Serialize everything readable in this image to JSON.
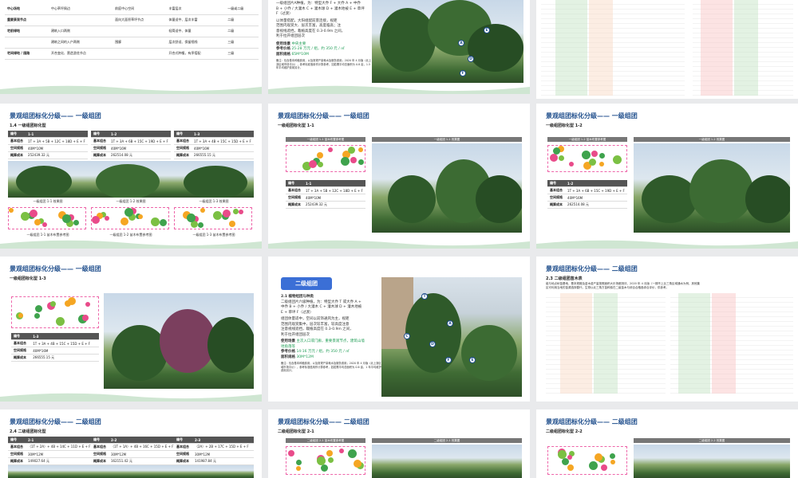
{
  "slides": {
    "s1": {
      "rows": [
        {
          "a": "中心场地",
          "b": "中心草坪周边",
          "c": "前庭中心空间",
          "d": "丰富层次",
          "e": "一级或二级"
        },
        {
          "a": "重要景观节点",
          "b": "",
          "c": "面向大面积草坪节点",
          "d": "体量适中、层次丰富",
          "e": "二级"
        },
        {
          "a": "宅前绿地",
          "b": "建筑入口两侧",
          "c": "",
          "d": "轻简适中、体量",
          "e": "二级"
        },
        {
          "a": "",
          "b": "建筑之间的入户两侧",
          "c": "围廊",
          "d": "层次舒适、保留视线",
          "e": "三级"
        },
        {
          "a": "宅间绿地 / 园路",
          "b": "开合变化、营造游览节点",
          "c": "",
          "d": "开合式种植，有序搭配",
          "e": "三级"
        }
      ]
    },
    "s2": {
      "lines": [
        "一级组团片A种植，为：特型大乔 F + 大乔 A + 中乔",
        "B + 小乔 / 大灌木 C + 灌木球 D + 灌木地被 E + 草坪",
        "F（过渡）",
        "以体量搭配，大阳组配前景连接，视距",
        "范围内观赏大、层次丰富，高度临高；注",
        "意视线遮挡，栽植高度在 0.3-0.9m 之间，",
        "利于拉开组团层次"
      ],
      "place_label": "使用场景",
      "place_value": "中央主要",
      "price_label": "参考价格",
      "price_value": "25-28 万元 / 组，约 350 元 / ㎡",
      "area_label": "面积规格",
      "area_value": "65M*10M",
      "note": "备注：包含基本种植费用，以及常规产量耗水及服务费用；2020 年 4 月版（北上浙区域市场平价），参考标准值用作计算参考，如若需平均总面积为 0.8 亩，1.5 年平均维护费用另计。"
    },
    "s4": {
      "title": "景观组团标化分级—— 一级组团",
      "subtitle": "1.4 一级组团标化型",
      "header": "编号",
      "tables": [
        {
          "code": "1-1",
          "combo": "1T + 3A + 5B + 12C + 18D + E + F",
          "space": "40M*10M",
          "cost": "252439.32 元"
        },
        {
          "code": "1-2",
          "combo": "1T + 3A + 6B + 15C + 19D + E + F",
          "space": "40M*16M",
          "cost": "262514.08 元"
        },
        {
          "code": "1-3",
          "combo": "1T + 3A + 4B + 15C + 15D + E + F",
          "space": "40M*16M",
          "cost": "266555.15 元"
        }
      ],
      "row_labels": [
        "基本组合",
        "空间规格",
        "概算成本"
      ],
      "photo_caps": [
        "一级组团 1-1 效果图",
        "一级组团 1-2 效果图",
        "一级组团 1-3 效果图"
      ],
      "plan_caps": [
        "一级组团 1-1 苗木布置参考图",
        "一级组团 1-2 苗木布置参考图",
        "一级组团 1-3 苗木布置参考图"
      ]
    },
    "s5": {
      "title": "景观组团标化分级—— 一级组团",
      "subtitle": "一级组团标化型 1-1",
      "plan_bar": "一级组团 1-1 苗木布置参考图",
      "photo_bar": "一级组团 1-1 效果图",
      "code": "1-1",
      "combo": "1T + 3A + 5B + 12C + 18D + E + F",
      "space": "40M*10M",
      "cost": "252439.32 元"
    },
    "s6": {
      "title": "景观组团标化分级—— 一级组团",
      "subtitle": "一级组团标化型 1-2",
      "plan_bar": "一级组团 1-2 苗木布置参考图",
      "photo_bar": "一级组团 1-2 效果图",
      "code": "1-2",
      "combo": "1T + 3A + 6B + 15C + 19D + E + F",
      "space": "40M*16M",
      "cost": "262514.08 元"
    },
    "s7": {
      "title": "景观组团标化分级—— 一级组团",
      "subtitle": "一级组团标化型 1-3",
      "code": "1-3",
      "combo": "1T + 3A + 4B + 15C + 15D + E + F",
      "space": "40M*16M",
      "cost": "266555.15 元"
    },
    "s8": {
      "button": "二级组团",
      "heading": "2.1  植物组团与种类",
      "lines": [
        "二级组团片六级种植，为：特型大乔 T 或大乔 A +",
        "中乔 B + 小乔 / 大灌木 C + 灌木球 D + 灌木地被",
        "E + 草坪 F（过渡）",
        "组团体量适中，空间以前饰通风为主，视距",
        "范围内观赏集中，层次较丰富，较高度注意",
        "注意视线遮挡，栽植高度在 0.3-0.9m 之间，",
        "利于拉开组团层次"
      ],
      "place_label": "使用场景",
      "place_value": "主次入口或门廊，重要景观节点，建筑山墙",
      "place_value2": "地角落等",
      "price_label": "参考价格",
      "price_value": "14-16 万元 / 组，约 350 元 / ㎡",
      "area_label": "面积规格",
      "area_value": "30M*12M",
      "note": "备注：包含基本种植费用，以及常规产量耗水及服务费用；2020 年 4 月版（北上浙区域市场平价），参考标准值用作计算参考，如若需平均总面积为 0.6 亩，1 年平均维护费用另计。"
    },
    "s9": {
      "title": "景观组团标化分级—— 二级组团",
      "subtitle": "2.3 二级组团苗木表",
      "intro": "组与地点树苗基地，基本规格及苗木费产量按照面积大乐场都测评，2020 年 4 月版（一期不上比三角区域通水为例，其他集",
      "intro2": "区可利用当地的苗源选择替代，生物以北三角方苗种费在二级苗木与综合合格各综合评价，供参考。"
    },
    "s10": {
      "title": "景观组团标化分级—— 二级组团",
      "subtitle": "2.4 二级组团标化型",
      "header": "编号",
      "tables": [
        {
          "code": "2-1",
          "combo": "（1T + 2A）+ 4B + 14C + 11D + E + F",
          "space": "30M*12M",
          "cost": "149027.64 元"
        },
        {
          "code": "2-2",
          "combo": "（1T + 1A）+ 4B + 16C + 15D + E + F",
          "space": "30M*12M",
          "cost": "162151.42 元"
        },
        {
          "code": "2-3",
          "combo": "（2A）+ 2B + 17C + 15D + E + F",
          "space": "30M*12M",
          "cost": "141987.84 元"
        }
      ],
      "row_labels": [
        "基本组合",
        "空间规格",
        "概算成本"
      ]
    },
    "s11": {
      "title": "景观组团标化分级—— 二级组团",
      "subtitle": "二级组团标化型 2-1",
      "plan_bar": "二级组团 2-1 苗木布置参考图",
      "photo_bar": "二级组团 2-1 效果图"
    },
    "s12": {
      "title": "景观组团标化分级—— 二级组团",
      "subtitle": "二级组团标化型 2-2",
      "photo_bar": "二级组团 2-2 效果图"
    }
  },
  "labels": {
    "code": "编号",
    "combo": "基本组合",
    "space": "空间规格",
    "cost": "概算成本"
  },
  "colors": {
    "accent": "#1f4e8c",
    "button": "#3b6fd6",
    "green_text": "#1f9d55",
    "header": "#555555"
  }
}
